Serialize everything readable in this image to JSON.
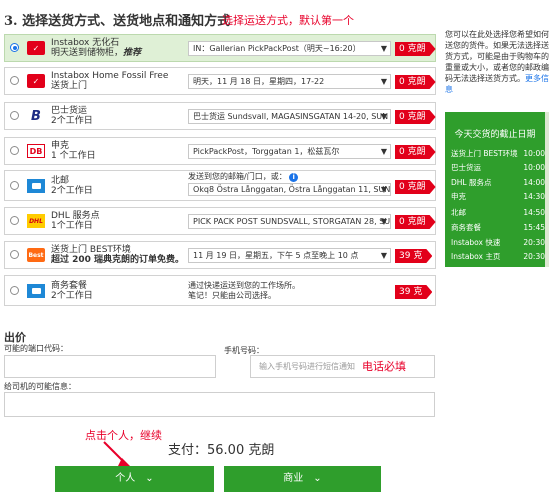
{
  "heading": {
    "title": "3. 选择送货方式、送货地点和通知方式",
    "annotation": "选择运送方式，默认第一个"
  },
  "options": [
    {
      "name": "Instabox 无化石",
      "sub_prefix": "明天送到储物柜，",
      "sub_bold": "推荐",
      "logo_icon": "instabox-logo-icon",
      "control": "IN：Gallerian PickPackPost（明天~16:20）",
      "price": "0 克朗",
      "selected": true
    },
    {
      "name": "Instabox Home Fossil Free",
      "sub": "送货上门",
      "logo_icon": "instabox-logo-icon",
      "control": "明天，11 月 18 日，星期四，17-22",
      "price": "0 克朗",
      "selected": false
    },
    {
      "name": "巴士货运",
      "sub": "2个工作日",
      "logo_icon": "bussgods-logo-icon",
      "control": "巴士货运 Sundsvall, MAGASINSGATAN 14-20, SUN",
      "price": "0 克朗",
      "selected": false
    },
    {
      "name": "申克",
      "sub": "1 个工作日",
      "logo_icon": "db-schenker-logo-icon",
      "control": "PickPackPost，Torggatan 1，松兹瓦尔",
      "price": "0 克朗",
      "selected": false
    },
    {
      "name": "北邮",
      "sub": "2个工作日",
      "logo_icon": "postnord-logo-icon",
      "detail_line": "发送到您的邮箱/门口，或：",
      "control": "Okq8 Östra Långgatan, Östra Långgatan 11, SUNE",
      "price": "0 克朗",
      "selected": false
    },
    {
      "name": "DHL 服务点",
      "sub": "1个工作日",
      "logo_icon": "dhl-logo-icon",
      "control": "PICK PACK POST SUNDSVALL, STORGATAN 28, SU",
      "price": "0 克朗",
      "selected": false
    },
    {
      "name": "送货上门 BEST环境",
      "sub": "超过 200 瑞典克朗的订单免费。",
      "logo_icon": "best-logo-icon",
      "control": "11 月 19 日，星期五，下午 5 点至晚上 10 点",
      "price": "39 克",
      "selected": false
    },
    {
      "name": "商务套餐",
      "sub": "2个工作日",
      "logo_icon": "business-package-icon",
      "detail_line": "通过快递运送到您的工作场所。",
      "detail_line2": "笔记！只能由公司选择。",
      "price": "39 克",
      "selected": false
    }
  ],
  "logos": {
    "instabox": "✓",
    "bussgods": "B",
    "db": "DB",
    "dhl": "DHL",
    "best": "Best"
  },
  "info": {
    "text": "您可以在此处选择您希望如何送您的货件。如果无法选择送货方式，可能是由于购物车的重量或大小，或者您的邮政编码无法选择送货方式。",
    "link": "更多信息"
  },
  "cutoff": {
    "title": "今天交货的截止日期",
    "rows": [
      {
        "name": "送货上门 BEST环境",
        "time": "10:00"
      },
      {
        "name": "巴士货运",
        "time": "10:00"
      },
      {
        "name": "DHL 服务点",
        "time": "14:00"
      },
      {
        "name": "申克",
        "time": "14:30"
      },
      {
        "name": "北邮",
        "time": "14:50"
      },
      {
        "name": "商务套餐",
        "time": "15:45"
      },
      {
        "name": "Instabox 快速",
        "time": "20:30"
      },
      {
        "name": "Instabox 主页",
        "time": "20:30"
      }
    ]
  },
  "checkout": {
    "title": "出价",
    "door_code_label": "可能的端口代码：",
    "phone_label": "手机号码：",
    "phone_placeholder": "输入手机号码进行短信通知",
    "phone_annotation": "电话必填",
    "driver_message_label": "给司机的可能信息：",
    "click_annotation": "点击个人，继续",
    "total": "支付：56.00 克朗",
    "private_button": "个人",
    "business_button": "商业",
    "chevron": "⌄"
  },
  "colors": {
    "accent_green": "#2f9e2c",
    "price_red": "#e2001a",
    "annotation_red": "#e8002a",
    "selected_bg": "#dff0d6"
  }
}
